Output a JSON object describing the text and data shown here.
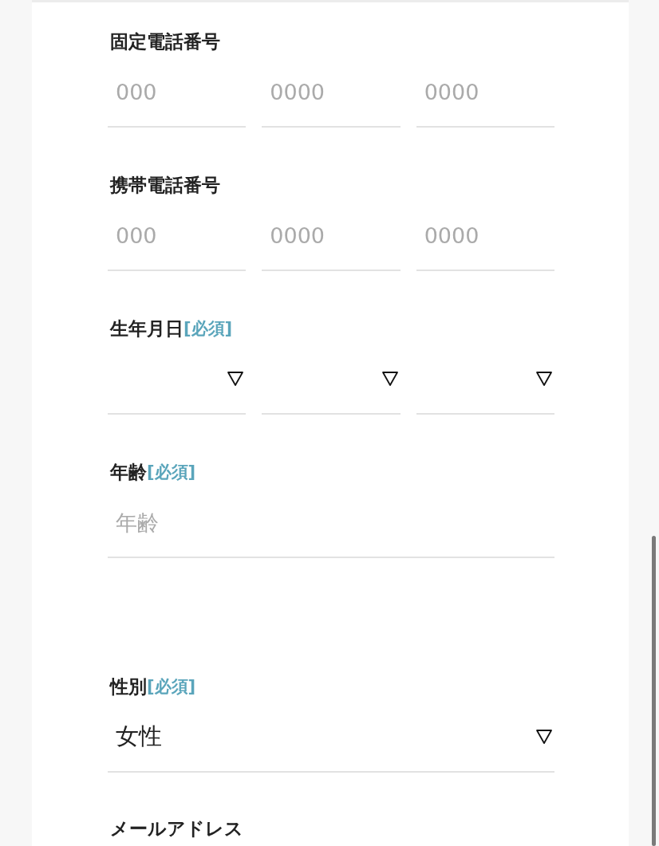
{
  "form": {
    "sections": [
      {
        "kind": "triple-input",
        "label": "固定電話番号",
        "fields": [
          {
            "placeholder": "000"
          },
          {
            "placeholder": "0000"
          },
          {
            "placeholder": "0000"
          }
        ]
      },
      {
        "kind": "triple-input",
        "label": "携帯電話番号",
        "fields": [
          {
            "placeholder": "000"
          },
          {
            "placeholder": "0000"
          },
          {
            "placeholder": "0000"
          }
        ]
      },
      {
        "kind": "triple-select",
        "label": "生年月日",
        "required_tag": "[必須]"
      },
      {
        "kind": "input",
        "label": "年齢",
        "required_tag": "[必須]",
        "fields": [
          {
            "placeholder": "年齢"
          }
        ]
      },
      {
        "kind": "select",
        "label": "性別",
        "required_tag": "[必須]",
        "fields": [
          {
            "value": "女性"
          }
        ]
      },
      {
        "kind": "heading",
        "label": "メールアドレス"
      }
    ]
  }
}
